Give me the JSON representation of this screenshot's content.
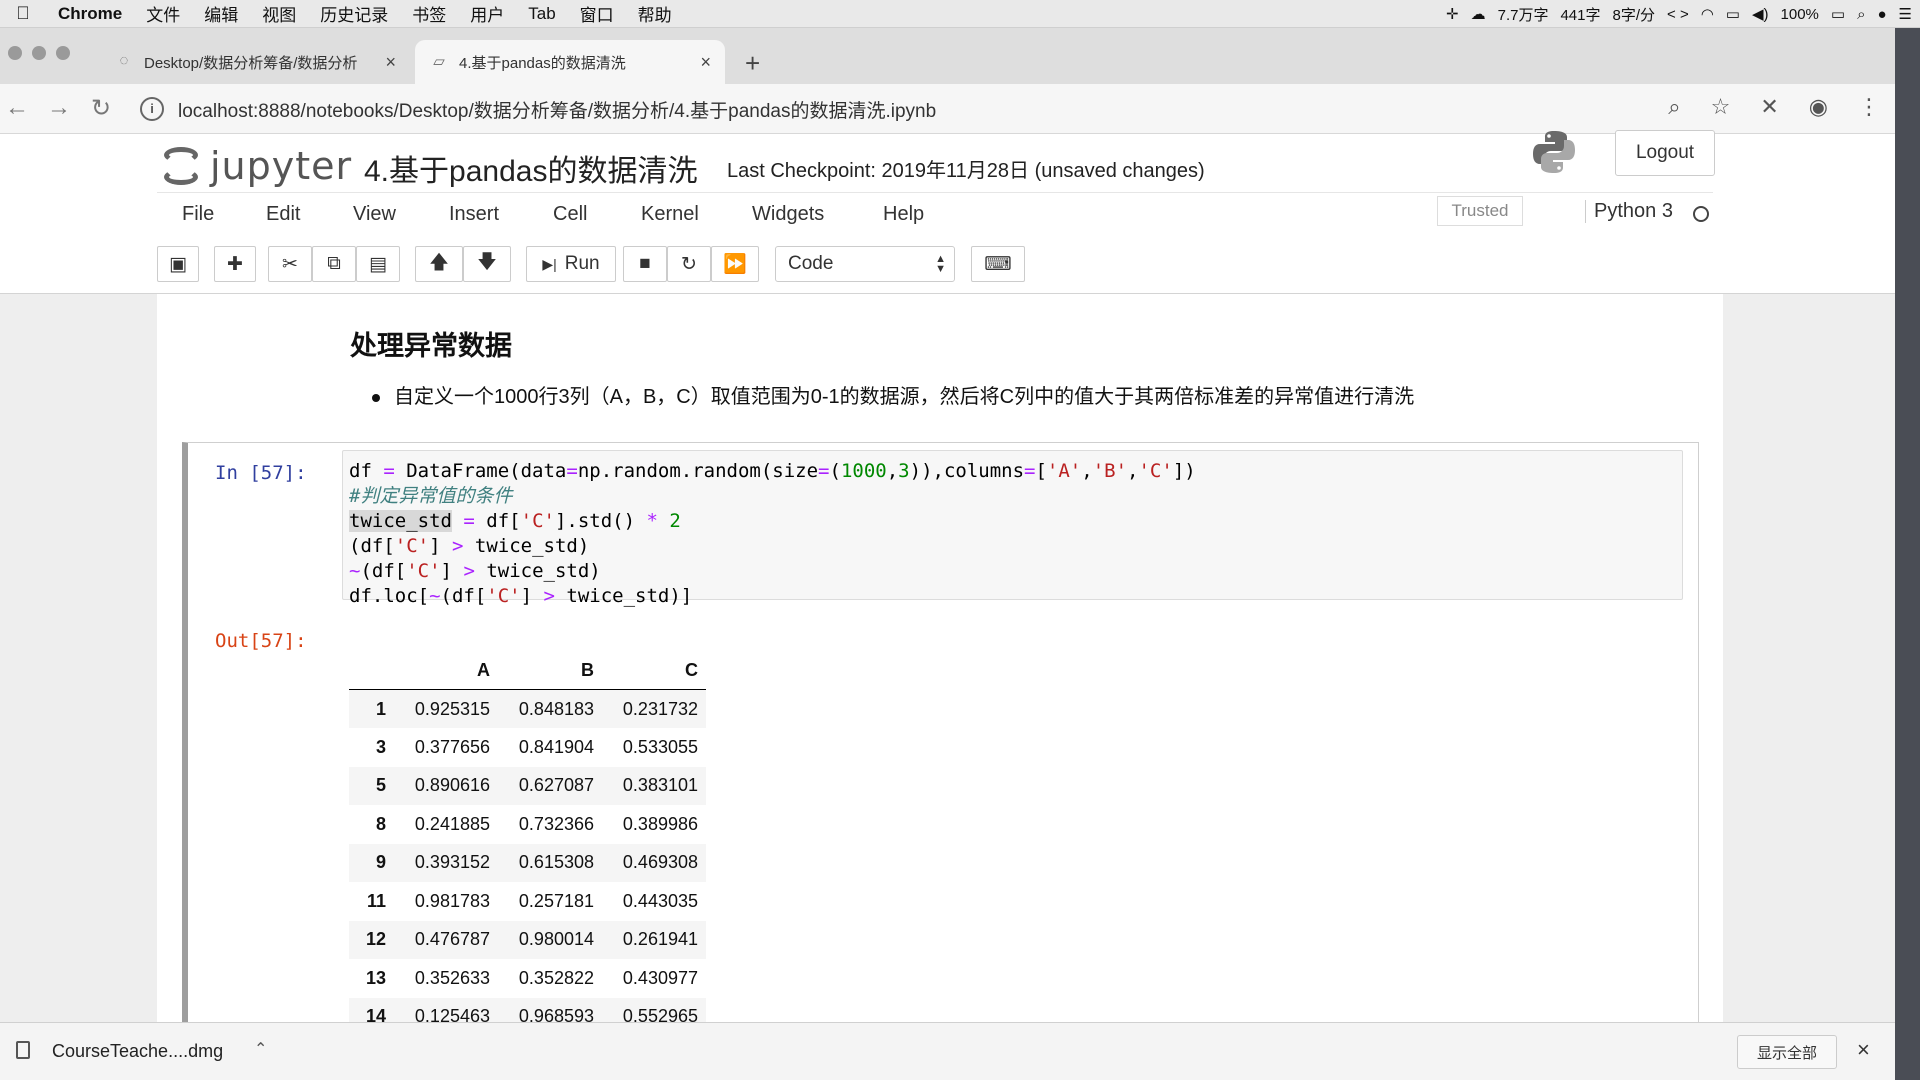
{
  "menubar": {
    "app": "Chrome",
    "items": [
      "文件",
      "编辑",
      "视图",
      "历史记录",
      "书签",
      "用户",
      "Tab",
      "窗口",
      "帮助"
    ],
    "status": [
      "7.7万字",
      "441字",
      "8字/分",
      "100%"
    ]
  },
  "tabs": [
    {
      "title": "Desktop/数据分析筹备/数据分析",
      "close": "×"
    },
    {
      "title": "4.基于pandas的数据清洗",
      "close": "×"
    }
  ],
  "newtab": "+",
  "address": {
    "url": "localhost:8888/notebooks/Desktop/数据分析筹备/数据分析/4.基于pandas的数据清洗.ipynb",
    "info": "i"
  },
  "jupyter": {
    "logo_text": "jupyter",
    "notebook_title": "4.基于pandas的数据清洗",
    "checkpoint": "Last Checkpoint: 2019年11月28日   (unsaved changes)",
    "logout": "Logout",
    "menus": [
      "File",
      "Edit",
      "View",
      "Insert",
      "Cell",
      "Kernel",
      "Widgets",
      "Help"
    ],
    "trusted": "Trusted",
    "kernel": "Python 3",
    "run_label": "Run",
    "cell_type": "Code"
  },
  "markdown": {
    "heading": "处理异常数据",
    "bullet": "自定义一个1000行3列（A，B，C）取值范围为0-1的数据源，然后将C列中的值大于其两倍标准差的异常值进行清洗"
  },
  "cell": {
    "in_prompt": "In [57]:",
    "out_prompt": "Out[57]:"
  },
  "table": {
    "columns": [
      "A",
      "B",
      "C"
    ],
    "rows": [
      {
        "index": "1",
        "A": "0.925315",
        "B": "0.848183",
        "C": "0.231732"
      },
      {
        "index": "3",
        "A": "0.377656",
        "B": "0.841904",
        "C": "0.533055"
      },
      {
        "index": "5",
        "A": "0.890616",
        "B": "0.627087",
        "C": "0.383101"
      },
      {
        "index": "8",
        "A": "0.241885",
        "B": "0.732366",
        "C": "0.389986"
      },
      {
        "index": "9",
        "A": "0.393152",
        "B": "0.615308",
        "C": "0.469308"
      },
      {
        "index": "11",
        "A": "0.981783",
        "B": "0.257181",
        "C": "0.443035"
      },
      {
        "index": "12",
        "A": "0.476787",
        "B": "0.980014",
        "C": "0.261941"
      },
      {
        "index": "13",
        "A": "0.352633",
        "B": "0.352822",
        "C": "0.430977"
      },
      {
        "index": "14",
        "A": "0.125463",
        "B": "0.968593",
        "C": "0.552965"
      }
    ]
  },
  "downloads": {
    "file": "CourseTeache....dmg",
    "show_all": "显示全部",
    "close": "×"
  }
}
